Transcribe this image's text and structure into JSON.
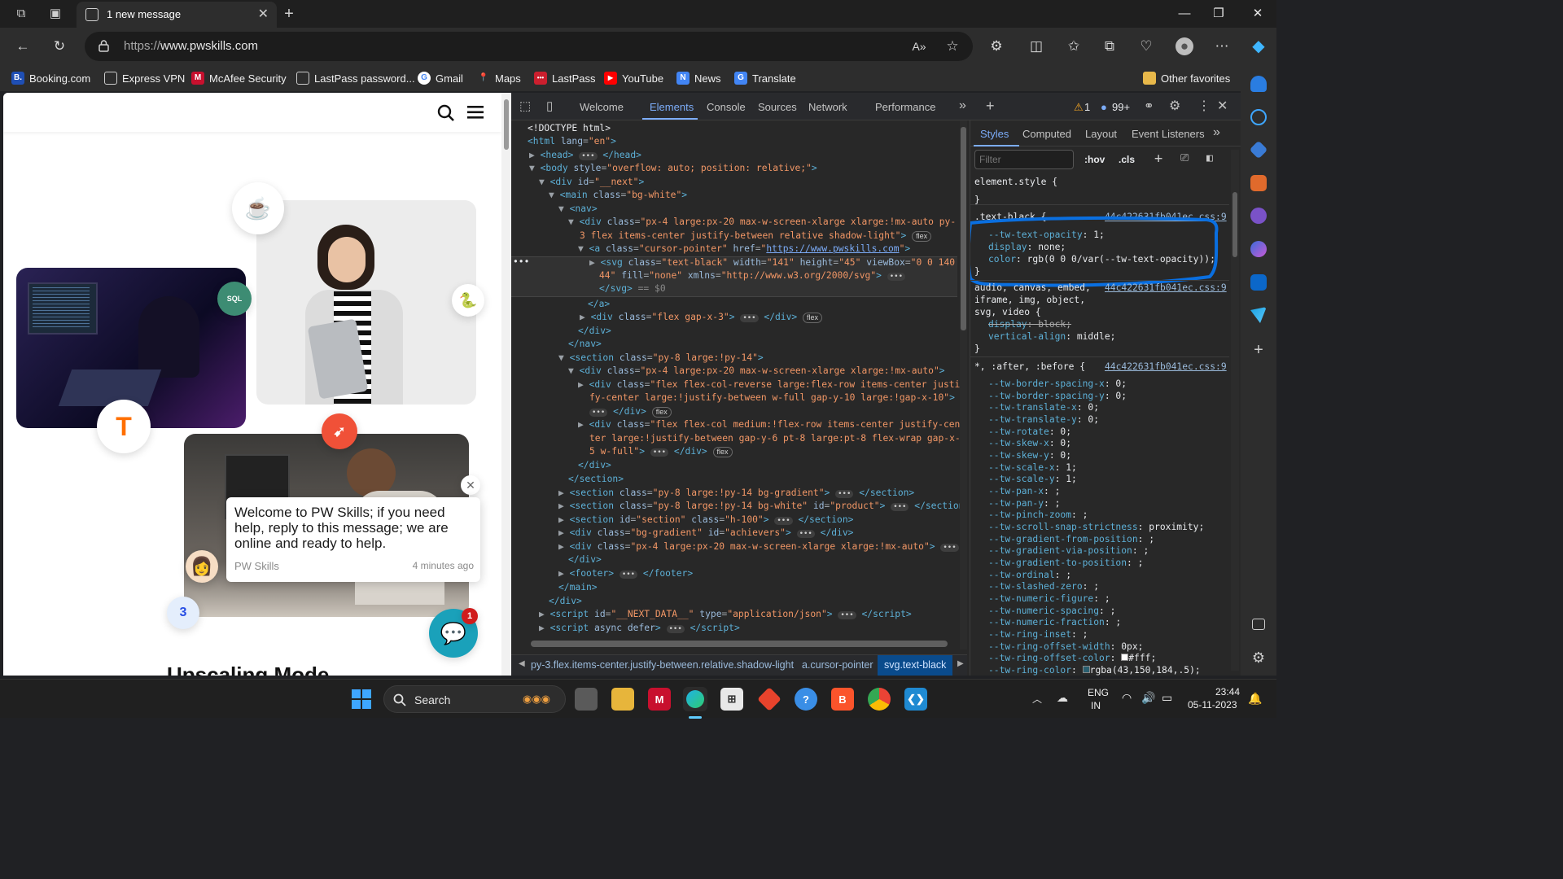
{
  "titlebar": {
    "tab_title": "1 new message",
    "minimize": "—",
    "maximize": "❐",
    "close": "✕",
    "new_tab": "+"
  },
  "navbar": {
    "url_prefix": "https://",
    "url_host": "www.pwskills.com"
  },
  "favorites": {
    "items": [
      "Booking.com",
      "Express VPN",
      "McAfee Security",
      "LastPass password...",
      "Gmail",
      "Maps",
      "LastPass",
      "YouTube",
      "News",
      "Translate"
    ],
    "other": "Other favorites"
  },
  "website": {
    "chat_message": "Welcome to PW Skills; if you need help, reply to this message; we are online and ready to help.",
    "chat_sender": "PW Skills",
    "chat_time": "4 minutes ago",
    "chat_badge": "1",
    "sql_label": "SQL",
    "partial_heading": "Upscaling Mode"
  },
  "devtools": {
    "tabs": [
      "Welcome",
      "Elements",
      "Console",
      "Sources",
      "Network",
      "Performance"
    ],
    "active_tab": "Elements",
    "warnings": "1",
    "messages": "99+",
    "breadcrumbs": [
      "py-3.flex.items-center.justify-between.relative.shadow-light",
      "a.cursor-pointer",
      "svg.text-black"
    ],
    "styles_tabs": [
      "Styles",
      "Computed",
      "Layout",
      "Event Listeners"
    ],
    "filter_placeholder": "Filter",
    "hov": ":hov",
    "cls": ".cls",
    "css_file": "44c422631fb041ec.css:9",
    "highlight_color": "#0a6fe0"
  },
  "system": {
    "search": "Search",
    "lang1": "ENG",
    "lang2": "IN",
    "time": "23:44",
    "date": "05-11-2023"
  }
}
